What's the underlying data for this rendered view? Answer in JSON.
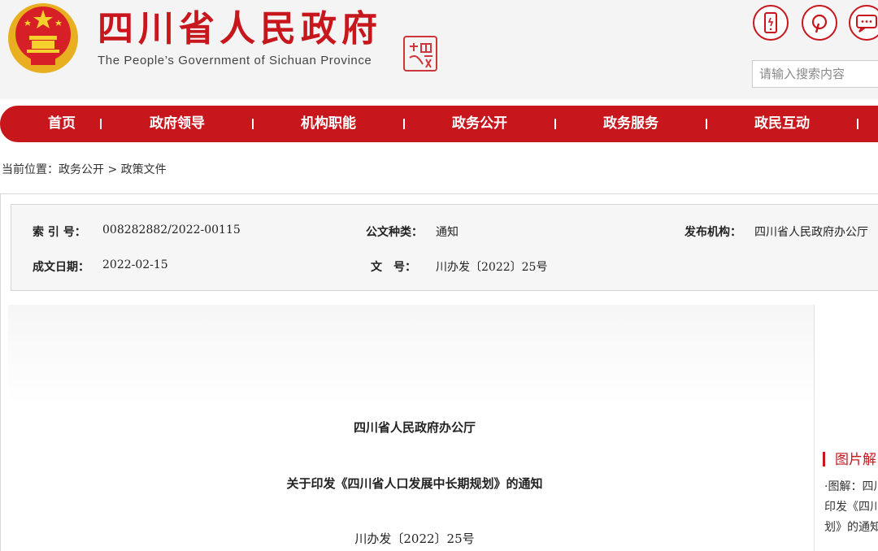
{
  "header": {
    "title": "四川省人民政府",
    "subtitle": "The People’s Government of Sichuan Province",
    "seal_text": "中國四川",
    "icons": [
      "mobile-icon",
      "weibo-icon",
      "message-icon"
    ],
    "search_placeholder": "请输入搜索内容",
    "brand_color": "#c8161d"
  },
  "nav": {
    "items": [
      "首页",
      "政府领导",
      "机构职能",
      "政务公开",
      "政务服务",
      "政民互动"
    ]
  },
  "breadcrumb": {
    "label": "当前位置：",
    "items": [
      "政务公开",
      "政策文件"
    ],
    "separator": " > "
  },
  "meta": {
    "index_label": "索 引 号：",
    "index_value": "008282882/2022-00115",
    "type_label": "公文种类：",
    "type_value": "通知",
    "publisher_label": "发布机构：",
    "publisher_value": "四川省人民政府办公厅",
    "date_label": "成文日期：",
    "date_value": "2022-02-15",
    "docno_label": "文　号：",
    "docno_value": "川办发〔2022〕25号"
  },
  "document": {
    "issuer": "四川省人民政府办公厅",
    "title": "关于印发《四川省人口发展中长期规划》的通知",
    "doc_number": "川办发〔2022〕25号"
  },
  "side": {
    "title": "图片解",
    "lines": [
      "·图解：四川",
      "印发《四川",
      "划》的通知"
    ]
  }
}
